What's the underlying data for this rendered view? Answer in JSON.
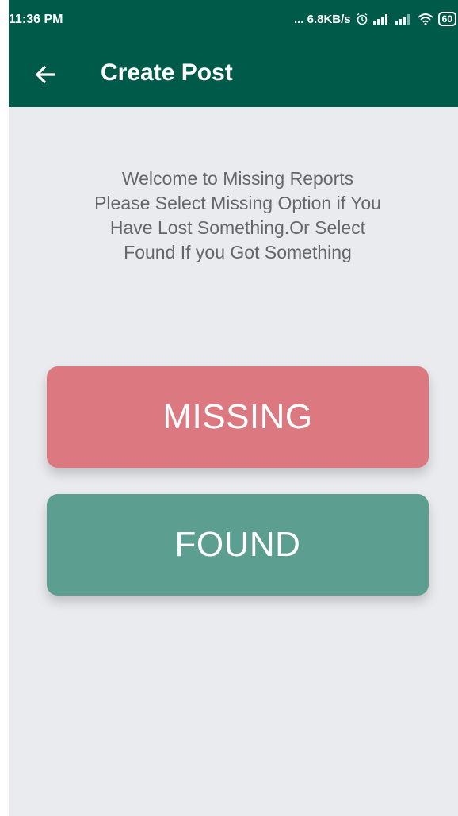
{
  "status_bar": {
    "time": "11:36 PM",
    "network_speed": "... 6.8KB/s",
    "battery": "60",
    "icons": [
      "alarm-icon",
      "signal-icon",
      "signal-icon",
      "wifi-icon",
      "battery-icon"
    ]
  },
  "app_bar": {
    "back_icon": "arrow-left-icon",
    "title": "Create Post"
  },
  "main": {
    "welcome_line1": "Welcome to Missing Reports",
    "welcome_line2": "Please Select Missing Option if You",
    "welcome_line3": "Have Lost Something.Or Select",
    "welcome_line4": "Found If you Got Something",
    "missing_label": "MISSING",
    "found_label": "FOUND"
  },
  "colors": {
    "primary": "#005a4a",
    "background": "#eaebee",
    "missing": "#dc7880",
    "found": "#5c9f90"
  }
}
